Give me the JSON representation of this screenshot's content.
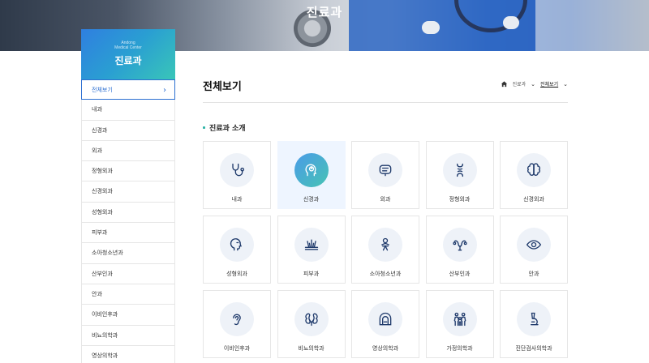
{
  "hero": {
    "title": "진료과"
  },
  "sidebar": {
    "eng_line1": "Andong",
    "eng_line2": "Medical Center",
    "title": "진료과",
    "items": [
      {
        "label": "전체보기"
      },
      {
        "label": "내과"
      },
      {
        "label": "신경과"
      },
      {
        "label": "외과"
      },
      {
        "label": "정형외과"
      },
      {
        "label": "신경외과"
      },
      {
        "label": "성형외과"
      },
      {
        "label": "피부과"
      },
      {
        "label": "소아청소년과"
      },
      {
        "label": "산부인과"
      },
      {
        "label": "안과"
      },
      {
        "label": "이비인후과"
      },
      {
        "label": "비뇨의학과"
      },
      {
        "label": "영상의학과"
      }
    ]
  },
  "main": {
    "title": "전체보기",
    "breadcrumb": {
      "level1": "진료과",
      "current": "전체보기"
    },
    "section_title": "진료과 소개",
    "departments": [
      {
        "label": "내과",
        "icon": "stethoscope-icon"
      },
      {
        "label": "신경과",
        "icon": "brain-head-icon"
      },
      {
        "label": "외과",
        "icon": "intestine-icon"
      },
      {
        "label": "정형외과",
        "icon": "bone-joint-icon"
      },
      {
        "label": "신경외과",
        "icon": "brain-icon"
      },
      {
        "label": "성형외과",
        "icon": "face-profile-icon"
      },
      {
        "label": "피부과",
        "icon": "skin-hair-icon"
      },
      {
        "label": "소아청소년과",
        "icon": "baby-icon"
      },
      {
        "label": "산부인과",
        "icon": "uterus-icon"
      },
      {
        "label": "안과",
        "icon": "eye-icon"
      },
      {
        "label": "이비인후과",
        "icon": "ear-icon"
      },
      {
        "label": "비뇨의학과",
        "icon": "kidney-icon"
      },
      {
        "label": "영상의학과",
        "icon": "mri-scanner-icon"
      },
      {
        "label": "가정의학과",
        "icon": "family-icon"
      },
      {
        "label": "진단검사의학과",
        "icon": "microscope-icon"
      }
    ]
  },
  "colors": {
    "accent": "#2c6fd1",
    "teal": "#2cb3a6",
    "icon": "#1f3a6b"
  }
}
